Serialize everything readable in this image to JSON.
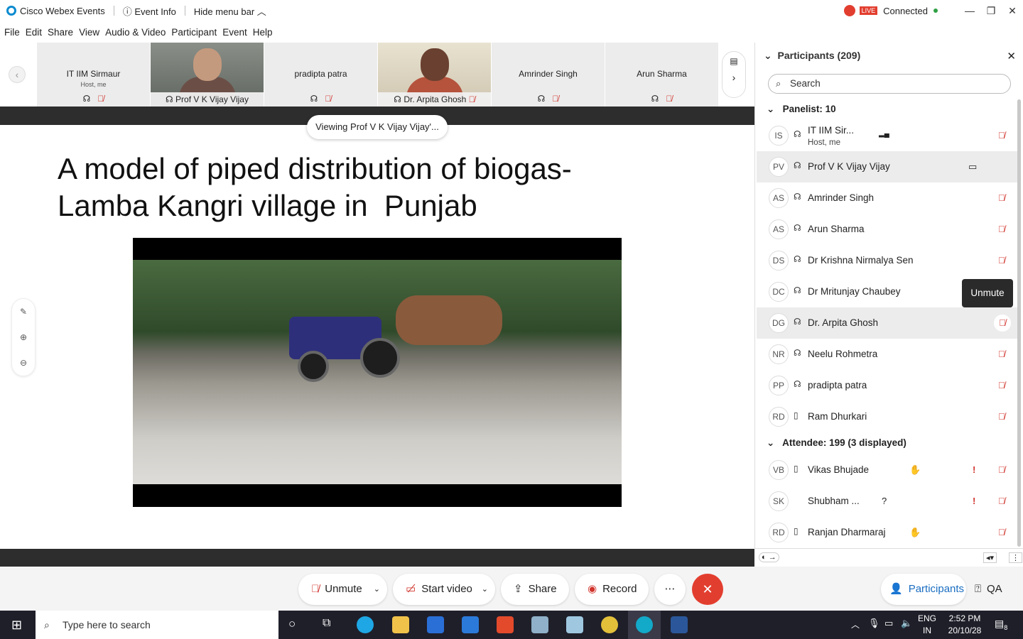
{
  "titlebar": {
    "app_name": "Cisco Webex Events",
    "event_info": "Event Info",
    "hide_menu": "Hide menu bar",
    "live": "LIVE",
    "status": "Connected"
  },
  "menu": [
    "File",
    "Edit",
    "Share",
    "View",
    "Audio & Video",
    "Participant",
    "Event",
    "Help"
  ],
  "strip": {
    "tiles": [
      {
        "name": "IT IIM Sirmaur",
        "sub": "Host, me"
      },
      {
        "name": "Prof V K Vijay Vijay"
      },
      {
        "name": "pradipta patra"
      },
      {
        "name": "Dr. Arpita Ghosh"
      },
      {
        "name": "Amrinder Singh"
      },
      {
        "name": "Arun Sharma"
      }
    ]
  },
  "stage": {
    "viewing": "Viewing Prof V K Vijay Vijay'...",
    "slide_title_1": "A model of piped distribution of biogas-",
    "slide_title_2": "Lamba Kangri village in  Punjab"
  },
  "panel": {
    "title": "Participants (209)",
    "search_placeholder": "Search",
    "panelist_header": "Panelist: 10",
    "attendee_header": "Attendee: 199 (3 displayed)",
    "tooltip": "Unmute",
    "panelists": [
      {
        "initials": "IS",
        "name": "IT IIM Sir...",
        "sub": "Host, me"
      },
      {
        "initials": "PV",
        "name": "Prof V K Vijay Vijay"
      },
      {
        "initials": "AS",
        "name": "Amrinder Singh"
      },
      {
        "initials": "AS",
        "name": "Arun Sharma"
      },
      {
        "initials": "DS",
        "name": "Dr Krishna Nirmalya Sen"
      },
      {
        "initials": "DC",
        "name": "Dr Mritunjay Chaubey"
      },
      {
        "initials": "DG",
        "name": "Dr. Arpita Ghosh"
      },
      {
        "initials": "NR",
        "name": "Neelu Rohmetra"
      },
      {
        "initials": "PP",
        "name": "pradipta patra"
      },
      {
        "initials": "RD",
        "name": "Ram Dhurkari"
      }
    ],
    "attendees": [
      {
        "initials": "VB",
        "name": "Vikas Bhujade"
      },
      {
        "initials": "SK",
        "name": "Shubham ..."
      },
      {
        "initials": "RD",
        "name": "Ranjan Dharmaraj"
      }
    ]
  },
  "controls": {
    "unmute": "Unmute",
    "start_video": "Start video",
    "share": "Share",
    "record": "Record",
    "participants": "Participants",
    "qa": "QA"
  },
  "taskbar": {
    "search_placeholder": "Type here to search",
    "lang_1": "ENG",
    "lang_2": "IN",
    "time": "2:52 PM",
    "date": "20/10/28",
    "notifications": "8"
  }
}
